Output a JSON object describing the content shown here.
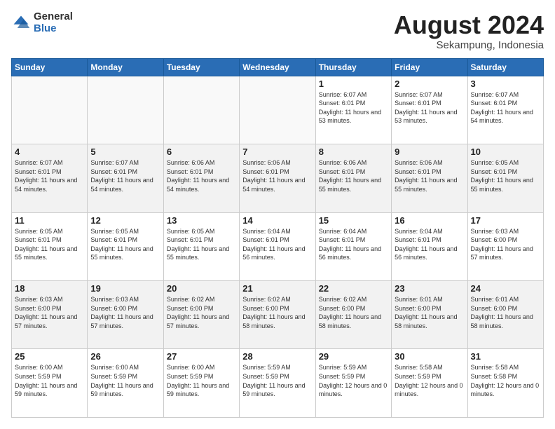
{
  "logo": {
    "general": "General",
    "blue": "Blue"
  },
  "title": "August 2024",
  "location": "Sekampung, Indonesia",
  "days_of_week": [
    "Sunday",
    "Monday",
    "Tuesday",
    "Wednesday",
    "Thursday",
    "Friday",
    "Saturday"
  ],
  "weeks": [
    [
      {
        "day": "",
        "sunrise": "",
        "sunset": "",
        "daylight": ""
      },
      {
        "day": "",
        "sunrise": "",
        "sunset": "",
        "daylight": ""
      },
      {
        "day": "",
        "sunrise": "",
        "sunset": "",
        "daylight": ""
      },
      {
        "day": "",
        "sunrise": "",
        "sunset": "",
        "daylight": ""
      },
      {
        "day": "1",
        "sunrise": "Sunrise: 6:07 AM",
        "sunset": "Sunset: 6:01 PM",
        "daylight": "Daylight: 11 hours and 53 minutes."
      },
      {
        "day": "2",
        "sunrise": "Sunrise: 6:07 AM",
        "sunset": "Sunset: 6:01 PM",
        "daylight": "Daylight: 11 hours and 53 minutes."
      },
      {
        "day": "3",
        "sunrise": "Sunrise: 6:07 AM",
        "sunset": "Sunset: 6:01 PM",
        "daylight": "Daylight: 11 hours and 54 minutes."
      }
    ],
    [
      {
        "day": "4",
        "sunrise": "Sunrise: 6:07 AM",
        "sunset": "Sunset: 6:01 PM",
        "daylight": "Daylight: 11 hours and 54 minutes."
      },
      {
        "day": "5",
        "sunrise": "Sunrise: 6:07 AM",
        "sunset": "Sunset: 6:01 PM",
        "daylight": "Daylight: 11 hours and 54 minutes."
      },
      {
        "day": "6",
        "sunrise": "Sunrise: 6:06 AM",
        "sunset": "Sunset: 6:01 PM",
        "daylight": "Daylight: 11 hours and 54 minutes."
      },
      {
        "day": "7",
        "sunrise": "Sunrise: 6:06 AM",
        "sunset": "Sunset: 6:01 PM",
        "daylight": "Daylight: 11 hours and 54 minutes."
      },
      {
        "day": "8",
        "sunrise": "Sunrise: 6:06 AM",
        "sunset": "Sunset: 6:01 PM",
        "daylight": "Daylight: 11 hours and 55 minutes."
      },
      {
        "day": "9",
        "sunrise": "Sunrise: 6:06 AM",
        "sunset": "Sunset: 6:01 PM",
        "daylight": "Daylight: 11 hours and 55 minutes."
      },
      {
        "day": "10",
        "sunrise": "Sunrise: 6:05 AM",
        "sunset": "Sunset: 6:01 PM",
        "daylight": "Daylight: 11 hours and 55 minutes."
      }
    ],
    [
      {
        "day": "11",
        "sunrise": "Sunrise: 6:05 AM",
        "sunset": "Sunset: 6:01 PM",
        "daylight": "Daylight: 11 hours and 55 minutes."
      },
      {
        "day": "12",
        "sunrise": "Sunrise: 6:05 AM",
        "sunset": "Sunset: 6:01 PM",
        "daylight": "Daylight: 11 hours and 55 minutes."
      },
      {
        "day": "13",
        "sunrise": "Sunrise: 6:05 AM",
        "sunset": "Sunset: 6:01 PM",
        "daylight": "Daylight: 11 hours and 55 minutes."
      },
      {
        "day": "14",
        "sunrise": "Sunrise: 6:04 AM",
        "sunset": "Sunset: 6:01 PM",
        "daylight": "Daylight: 11 hours and 56 minutes."
      },
      {
        "day": "15",
        "sunrise": "Sunrise: 6:04 AM",
        "sunset": "Sunset: 6:01 PM",
        "daylight": "Daylight: 11 hours and 56 minutes."
      },
      {
        "day": "16",
        "sunrise": "Sunrise: 6:04 AM",
        "sunset": "Sunset: 6:01 PM",
        "daylight": "Daylight: 11 hours and 56 minutes."
      },
      {
        "day": "17",
        "sunrise": "Sunrise: 6:03 AM",
        "sunset": "Sunset: 6:00 PM",
        "daylight": "Daylight: 11 hours and 57 minutes."
      }
    ],
    [
      {
        "day": "18",
        "sunrise": "Sunrise: 6:03 AM",
        "sunset": "Sunset: 6:00 PM",
        "daylight": "Daylight: 11 hours and 57 minutes."
      },
      {
        "day": "19",
        "sunrise": "Sunrise: 6:03 AM",
        "sunset": "Sunset: 6:00 PM",
        "daylight": "Daylight: 11 hours and 57 minutes."
      },
      {
        "day": "20",
        "sunrise": "Sunrise: 6:02 AM",
        "sunset": "Sunset: 6:00 PM",
        "daylight": "Daylight: 11 hours and 57 minutes."
      },
      {
        "day": "21",
        "sunrise": "Sunrise: 6:02 AM",
        "sunset": "Sunset: 6:00 PM",
        "daylight": "Daylight: 11 hours and 58 minutes."
      },
      {
        "day": "22",
        "sunrise": "Sunrise: 6:02 AM",
        "sunset": "Sunset: 6:00 PM",
        "daylight": "Daylight: 11 hours and 58 minutes."
      },
      {
        "day": "23",
        "sunrise": "Sunrise: 6:01 AM",
        "sunset": "Sunset: 6:00 PM",
        "daylight": "Daylight: 11 hours and 58 minutes."
      },
      {
        "day": "24",
        "sunrise": "Sunrise: 6:01 AM",
        "sunset": "Sunset: 6:00 PM",
        "daylight": "Daylight: 11 hours and 58 minutes."
      }
    ],
    [
      {
        "day": "25",
        "sunrise": "Sunrise: 6:00 AM",
        "sunset": "Sunset: 5:59 PM",
        "daylight": "Daylight: 11 hours and 59 minutes."
      },
      {
        "day": "26",
        "sunrise": "Sunrise: 6:00 AM",
        "sunset": "Sunset: 5:59 PM",
        "daylight": "Daylight: 11 hours and 59 minutes."
      },
      {
        "day": "27",
        "sunrise": "Sunrise: 6:00 AM",
        "sunset": "Sunset: 5:59 PM",
        "daylight": "Daylight: 11 hours and 59 minutes."
      },
      {
        "day": "28",
        "sunrise": "Sunrise: 5:59 AM",
        "sunset": "Sunset: 5:59 PM",
        "daylight": "Daylight: 11 hours and 59 minutes."
      },
      {
        "day": "29",
        "sunrise": "Sunrise: 5:59 AM",
        "sunset": "Sunset: 5:59 PM",
        "daylight": "Daylight: 12 hours and 0 minutes."
      },
      {
        "day": "30",
        "sunrise": "Sunrise: 5:58 AM",
        "sunset": "Sunset: 5:59 PM",
        "daylight": "Daylight: 12 hours and 0 minutes."
      },
      {
        "day": "31",
        "sunrise": "Sunrise: 5:58 AM",
        "sunset": "Sunset: 5:58 PM",
        "daylight": "Daylight: 12 hours and 0 minutes."
      }
    ]
  ]
}
